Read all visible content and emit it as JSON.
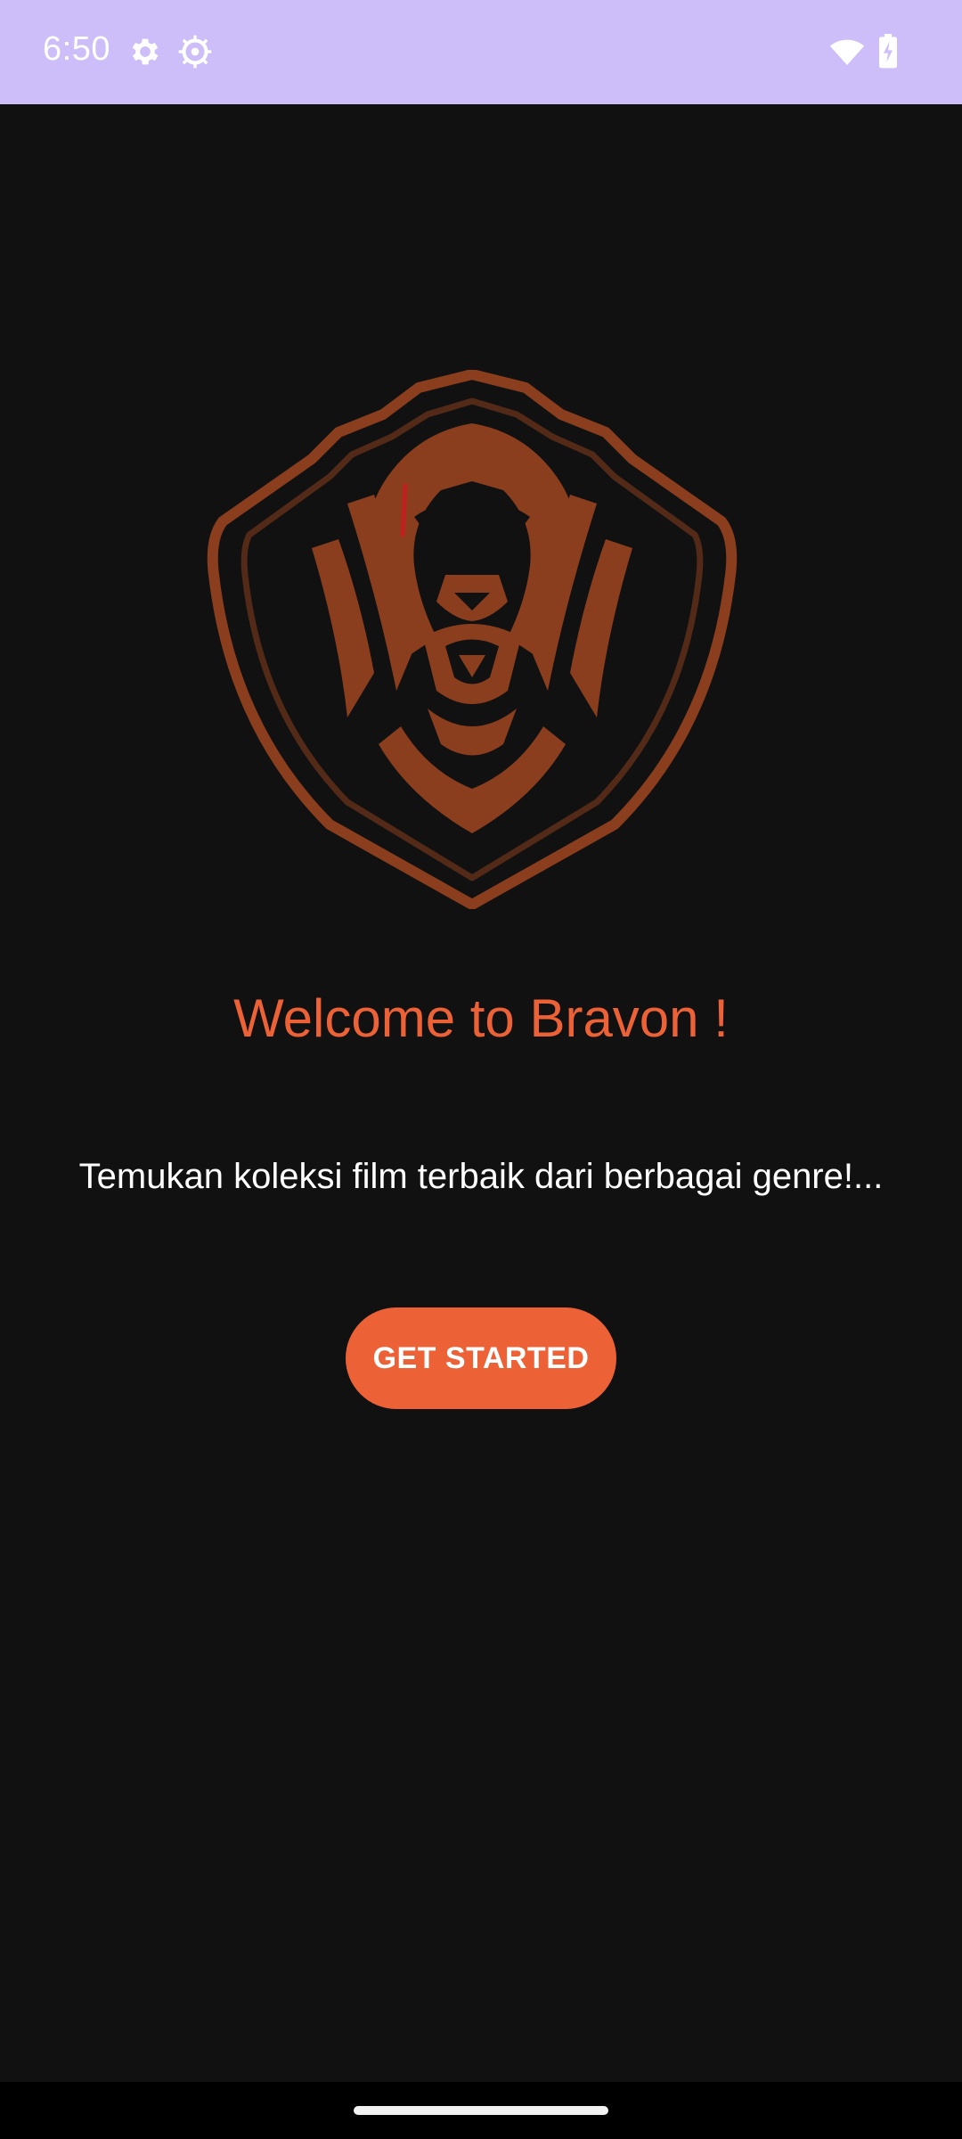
{
  "status_bar": {
    "time": "6:50",
    "icons": [
      "gear-icon",
      "crosshair-gear-icon",
      "wifi-icon",
      "battery-charging-icon"
    ],
    "background": "#cdbdf8"
  },
  "logo": {
    "icon": "lion-shield-logo",
    "color": "#8a3e1e"
  },
  "welcome": {
    "title": "Welcome to Bravon !"
  },
  "intro": {
    "text": "Temukan koleksi film terbaik dari berbagai genre!..."
  },
  "actions": {
    "get_started_label": "GET STARTED"
  },
  "colors": {
    "accent": "#ec6236",
    "background": "#111111",
    "text": "#ffffff"
  }
}
